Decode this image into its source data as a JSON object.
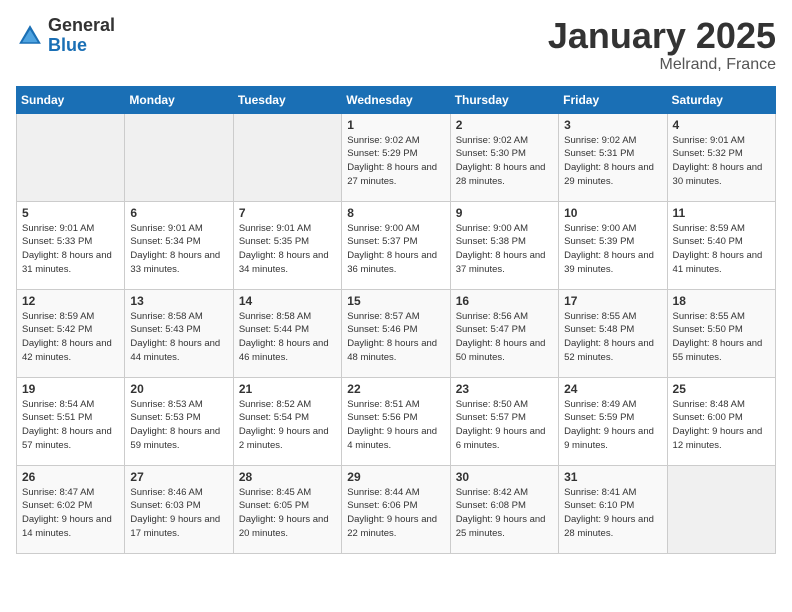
{
  "header": {
    "logo_general": "General",
    "logo_blue": "Blue",
    "month_year": "January 2025",
    "location": "Melrand, France"
  },
  "days_of_week": [
    "Sunday",
    "Monday",
    "Tuesday",
    "Wednesday",
    "Thursday",
    "Friday",
    "Saturday"
  ],
  "weeks": [
    [
      {
        "day": "",
        "info": ""
      },
      {
        "day": "",
        "info": ""
      },
      {
        "day": "",
        "info": ""
      },
      {
        "day": "1",
        "info": "Sunrise: 9:02 AM\nSunset: 5:29 PM\nDaylight: 8 hours and 27 minutes."
      },
      {
        "day": "2",
        "info": "Sunrise: 9:02 AM\nSunset: 5:30 PM\nDaylight: 8 hours and 28 minutes."
      },
      {
        "day": "3",
        "info": "Sunrise: 9:02 AM\nSunset: 5:31 PM\nDaylight: 8 hours and 29 minutes."
      },
      {
        "day": "4",
        "info": "Sunrise: 9:01 AM\nSunset: 5:32 PM\nDaylight: 8 hours and 30 minutes."
      }
    ],
    [
      {
        "day": "5",
        "info": "Sunrise: 9:01 AM\nSunset: 5:33 PM\nDaylight: 8 hours and 31 minutes."
      },
      {
        "day": "6",
        "info": "Sunrise: 9:01 AM\nSunset: 5:34 PM\nDaylight: 8 hours and 33 minutes."
      },
      {
        "day": "7",
        "info": "Sunrise: 9:01 AM\nSunset: 5:35 PM\nDaylight: 8 hours and 34 minutes."
      },
      {
        "day": "8",
        "info": "Sunrise: 9:00 AM\nSunset: 5:37 PM\nDaylight: 8 hours and 36 minutes."
      },
      {
        "day": "9",
        "info": "Sunrise: 9:00 AM\nSunset: 5:38 PM\nDaylight: 8 hours and 37 minutes."
      },
      {
        "day": "10",
        "info": "Sunrise: 9:00 AM\nSunset: 5:39 PM\nDaylight: 8 hours and 39 minutes."
      },
      {
        "day": "11",
        "info": "Sunrise: 8:59 AM\nSunset: 5:40 PM\nDaylight: 8 hours and 41 minutes."
      }
    ],
    [
      {
        "day": "12",
        "info": "Sunrise: 8:59 AM\nSunset: 5:42 PM\nDaylight: 8 hours and 42 minutes."
      },
      {
        "day": "13",
        "info": "Sunrise: 8:58 AM\nSunset: 5:43 PM\nDaylight: 8 hours and 44 minutes."
      },
      {
        "day": "14",
        "info": "Sunrise: 8:58 AM\nSunset: 5:44 PM\nDaylight: 8 hours and 46 minutes."
      },
      {
        "day": "15",
        "info": "Sunrise: 8:57 AM\nSunset: 5:46 PM\nDaylight: 8 hours and 48 minutes."
      },
      {
        "day": "16",
        "info": "Sunrise: 8:56 AM\nSunset: 5:47 PM\nDaylight: 8 hours and 50 minutes."
      },
      {
        "day": "17",
        "info": "Sunrise: 8:55 AM\nSunset: 5:48 PM\nDaylight: 8 hours and 52 minutes."
      },
      {
        "day": "18",
        "info": "Sunrise: 8:55 AM\nSunset: 5:50 PM\nDaylight: 8 hours and 55 minutes."
      }
    ],
    [
      {
        "day": "19",
        "info": "Sunrise: 8:54 AM\nSunset: 5:51 PM\nDaylight: 8 hours and 57 minutes."
      },
      {
        "day": "20",
        "info": "Sunrise: 8:53 AM\nSunset: 5:53 PM\nDaylight: 8 hours and 59 minutes."
      },
      {
        "day": "21",
        "info": "Sunrise: 8:52 AM\nSunset: 5:54 PM\nDaylight: 9 hours and 2 minutes."
      },
      {
        "day": "22",
        "info": "Sunrise: 8:51 AM\nSunset: 5:56 PM\nDaylight: 9 hours and 4 minutes."
      },
      {
        "day": "23",
        "info": "Sunrise: 8:50 AM\nSunset: 5:57 PM\nDaylight: 9 hours and 6 minutes."
      },
      {
        "day": "24",
        "info": "Sunrise: 8:49 AM\nSunset: 5:59 PM\nDaylight: 9 hours and 9 minutes."
      },
      {
        "day": "25",
        "info": "Sunrise: 8:48 AM\nSunset: 6:00 PM\nDaylight: 9 hours and 12 minutes."
      }
    ],
    [
      {
        "day": "26",
        "info": "Sunrise: 8:47 AM\nSunset: 6:02 PM\nDaylight: 9 hours and 14 minutes."
      },
      {
        "day": "27",
        "info": "Sunrise: 8:46 AM\nSunset: 6:03 PM\nDaylight: 9 hours and 17 minutes."
      },
      {
        "day": "28",
        "info": "Sunrise: 8:45 AM\nSunset: 6:05 PM\nDaylight: 9 hours and 20 minutes."
      },
      {
        "day": "29",
        "info": "Sunrise: 8:44 AM\nSunset: 6:06 PM\nDaylight: 9 hours and 22 minutes."
      },
      {
        "day": "30",
        "info": "Sunrise: 8:42 AM\nSunset: 6:08 PM\nDaylight: 9 hours and 25 minutes."
      },
      {
        "day": "31",
        "info": "Sunrise: 8:41 AM\nSunset: 6:10 PM\nDaylight: 9 hours and 28 minutes."
      },
      {
        "day": "",
        "info": ""
      }
    ]
  ]
}
